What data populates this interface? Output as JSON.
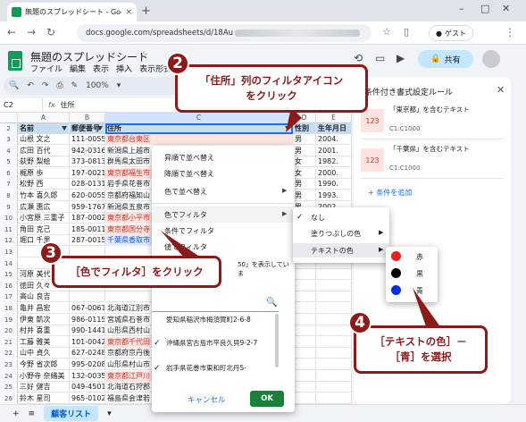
{
  "browser": {
    "tab_title": "無題のスプレッドシート - Google ス",
    "tab_close": "×",
    "new_tab": "+",
    "url_visible": "docs.google.com/spreadsheets/d/18Au",
    "guest_label": "ゲスト"
  },
  "sheets": {
    "title": "無題のスプレッドシート",
    "menu": [
      "ファイル",
      "編集",
      "表示",
      "挿入",
      "表示形式"
    ],
    "share_label": "共有",
    "zoom": "100%",
    "cell_ref": "C2",
    "formula": "住所",
    "columns": [
      "A",
      "B",
      "C",
      "D",
      "E"
    ],
    "header_row": [
      "名前",
      "郵便番号",
      "住所",
      "性別",
      "生年月日"
    ],
    "rows": [
      {
        "n": "3",
        "name": "山根 文之",
        "zip": "111-0055",
        "addr": "東京都台東区",
        "addr_color": "red",
        "sex": "男",
        "dob": "2004."
      },
      {
        "n": "4",
        "name": "広田 百代",
        "zip": "942-0316",
        "addr": "新潟県上越市",
        "addr_color": "",
        "sex": "男",
        "dob": "2001."
      },
      {
        "n": "5",
        "name": "荻野 梨絵",
        "zip": "373-0813",
        "addr": "群馬県太田市",
        "addr_color": "",
        "sex": "女",
        "dob": "1982."
      },
      {
        "n": "6",
        "name": "梶原 歩",
        "zip": "197-0021",
        "addr": "東京都福生市",
        "addr_color": "red",
        "sex": "女",
        "dob": "2000."
      },
      {
        "n": "7",
        "name": "松野 西",
        "zip": "028-0131",
        "addr": "岩手県花巻市",
        "addr_color": "",
        "sex": "男",
        "dob": "1990."
      },
      {
        "n": "8",
        "name": "竹本 喜久郎",
        "zip": "620-0055",
        "addr": "京都府福知山",
        "addr_color": "",
        "sex": "男",
        "dob": "1993."
      },
      {
        "n": "9",
        "name": "広瀬 惠広",
        "zip": "959-1767",
        "addr": "新潟県五泉市",
        "addr_color": "",
        "sex": "男",
        "dob": "2002."
      },
      {
        "n": "10",
        "name": "小宮原 三重子",
        "zip": "187-0002",
        "addr": "東京都小平市",
        "addr_color": "red",
        "sex": "女",
        "dob": "1988."
      },
      {
        "n": "11",
        "name": "角田 克己",
        "zip": "185-0011",
        "addr": "東京都国分寺",
        "addr_color": "red",
        "sex": "男",
        "dob": "1995."
      },
      {
        "n": "12",
        "name": "堀口 千里",
        "zip": "287-0015",
        "addr": "千葉県香取市",
        "addr_color": "blue",
        "sex": "男",
        "dob": "1973."
      },
      {
        "n": "13",
        "name": "",
        "zip": "",
        "addr": "",
        "addr_color": "",
        "sex": "",
        "dob": ""
      },
      {
        "n": "14",
        "name": "",
        "zip": "",
        "addr": "",
        "addr_color": "",
        "sex": "",
        "dob": ""
      },
      {
        "n": "15",
        "name": "河原 美代",
        "zip": "",
        "addr": "",
        "addr_color": "",
        "sex": "",
        "dob": ""
      },
      {
        "n": "16",
        "name": "徳田 久々",
        "zip": "",
        "addr": "",
        "addr_color": "",
        "sex": "",
        "dob": ""
      },
      {
        "n": "17",
        "name": "高山 良吉",
        "zip": "",
        "addr": "",
        "addr_color": "",
        "sex": "",
        "dob": ""
      },
      {
        "n": "18",
        "name": "亀井 昌宏",
        "zip": "067-0061",
        "addr": "北海道江別市",
        "addr_color": "",
        "sex": "",
        "dob": ""
      },
      {
        "n": "19",
        "name": "伊東 凱次",
        "zip": "986-0115",
        "addr": "宮城県石巻市",
        "addr_color": "",
        "sex": "",
        "dob": ""
      },
      {
        "n": "20",
        "name": "村井 喜重",
        "zip": "990-1441",
        "addr": "山形県西村山",
        "addr_color": "",
        "sex": "",
        "dob": ""
      },
      {
        "n": "21",
        "name": "工藤 雅美",
        "zip": "101-0042",
        "addr": "東京都千代田",
        "addr_color": "red",
        "sex": "",
        "dob": ""
      },
      {
        "n": "22",
        "name": "山中 貞久",
        "zip": "627-0248",
        "addr": "京都府京丹後",
        "addr_color": "",
        "sex": "",
        "dob": ""
      },
      {
        "n": "23",
        "name": "今野 省次郎",
        "zip": "995-0208",
        "addr": "山形県村山市",
        "addr_color": "",
        "sex": "",
        "dob": ""
      },
      {
        "n": "24",
        "name": "小野寺 奈緒美",
        "zip": "132-0035",
        "addr": "東京都江戸川",
        "addr_color": "red",
        "sex": "",
        "dob": ""
      },
      {
        "n": "25",
        "name": "三好 健吉",
        "zip": "049-4501",
        "addr": "北海道石狩郡",
        "addr_color": "",
        "sex": "",
        "dob": ""
      },
      {
        "n": "26",
        "name": "鈴木 星司",
        "zip": "965-0102",
        "addr": "福島県会津若",
        "addr_color": "",
        "sex": "",
        "dob": ""
      }
    ],
    "sheet_tab": "顧客リスト"
  },
  "side_panel": {
    "title": "条件付き書式設定ルール",
    "rules": [
      {
        "swatch": "123",
        "text": "「東京都」を含むテキスト",
        "range": "C1:C1000"
      },
      {
        "swatch": "123",
        "text": "「千葉県」を含むテキスト",
        "range": "C1:C1000"
      }
    ],
    "add_rule": "+ 条件を追加"
  },
  "filter_menu": {
    "items": [
      "昇順で並べ替え",
      "降順で並べ替え",
      "色で並べ替え",
      "色でフィルタ",
      "条件でフィルタ",
      "値でフィルタ"
    ],
    "partial_text": "50」を表示していま",
    "values": [
      {
        "check": "",
        "text": "愛知県稲沢市梅須賀町2-6-8"
      },
      {
        "check": "✓",
        "text": "沖縄県宮古島市平良久貝9-2-7"
      },
      {
        "check": "✓",
        "text": "岩手県花巻市東和町北丹5-"
      }
    ],
    "cancel": "キャンセル",
    "ok": "OK"
  },
  "color_submenu": {
    "items": [
      {
        "check": "✓",
        "text": "なし"
      },
      {
        "check": "",
        "text": "塗りつぶしの色"
      },
      {
        "check": "",
        "text": "テキストの色"
      }
    ]
  },
  "text_color_submenu": {
    "items": [
      {
        "color": "#e52020",
        "label": "赤"
      },
      {
        "color": "#000000",
        "label": "黒"
      },
      {
        "color": "#0033dd",
        "label": "青"
      }
    ]
  },
  "callouts": [
    {
      "num": "2",
      "text1": "「住所」列のフィルタアイコン",
      "text2": "をクリック"
    },
    {
      "num": "3",
      "text1": "［色でフィルタ］をクリック",
      "text2": ""
    },
    {
      "num": "4",
      "text1": "［テキストの色］－",
      "text2": "［青］を選択"
    }
  ]
}
